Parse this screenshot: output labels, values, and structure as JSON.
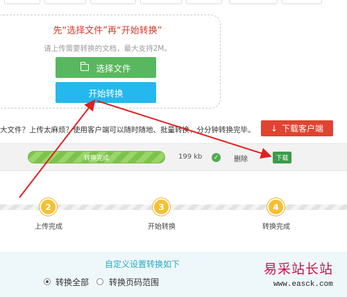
{
  "upload": {
    "title": "先“选择文件”再“开始转换”",
    "hint": "请上传需要转换的文档，最大支持2M。",
    "select_button": "选择文件",
    "start_button": "开始转换"
  },
  "client": {
    "text": "大文件？上传太麻烦？使用客户端可以随时随地、批量转换，分分钟转换完毕。",
    "download_button": "下载客户端"
  },
  "file_row": {
    "progress_label": "转换完成",
    "progress_percent": 100,
    "file_size": "199 kb",
    "delete_label": "删除",
    "download_label": "下载"
  },
  "steps": [
    {
      "number": "2",
      "label": "上传完成"
    },
    {
      "number": "3",
      "label": "开始转换"
    },
    {
      "number": "4",
      "label": "转换完成"
    }
  ],
  "settings": {
    "title": "自定义设置转换如下",
    "options": [
      {
        "label": "转换全部",
        "selected": true
      },
      {
        "label": "转换页码范围",
        "selected": false
      }
    ]
  },
  "watermark": {
    "title": "易采站长站",
    "url": "www.easck.com"
  },
  "colors": {
    "accent_red": "#d23a2a",
    "green_button": "#59b85f",
    "blue_button": "#24b8ef",
    "step_yellow": "#f6c032",
    "annotation_arrow": "#e02020"
  },
  "icons": [
    "folder-icon",
    "download-arrow-icon",
    "check-icon"
  ]
}
